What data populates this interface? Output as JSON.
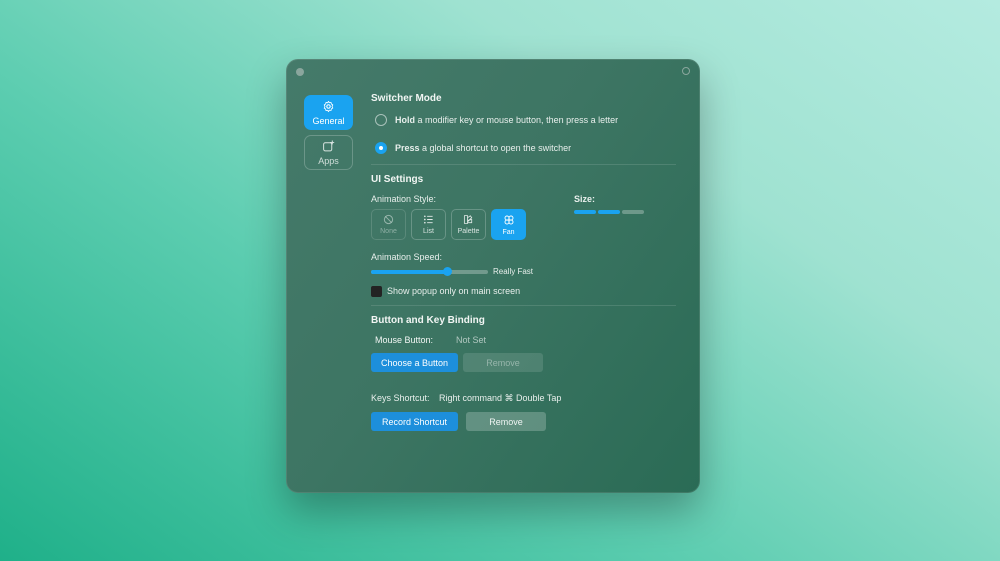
{
  "sidebar": {
    "tabs": [
      {
        "label": "General",
        "icon": "gear-icon",
        "active": true
      },
      {
        "label": "Apps",
        "icon": "app-add-icon",
        "active": false
      }
    ]
  },
  "switcher_mode": {
    "title": "Switcher Mode",
    "options": [
      {
        "bold": "Hold",
        "text": " a modifier key or mouse button, then press a letter",
        "selected": false
      },
      {
        "bold": "Press",
        "text": " a global shortcut to open the switcher",
        "selected": true
      }
    ]
  },
  "ui_settings": {
    "title": "UI Settings",
    "animation_style_label": "Animation Style:",
    "animation_styles": [
      {
        "label": "None",
        "icon": "prohibited-icon",
        "state": "disabled"
      },
      {
        "label": "List",
        "icon": "list-icon",
        "state": "off"
      },
      {
        "label": "Palette",
        "icon": "palette-icon",
        "state": "off"
      },
      {
        "label": "Fan",
        "icon": "fan-icon",
        "state": "selected"
      }
    ],
    "size_label": "Size:",
    "size_level": 2,
    "size_max": 3,
    "animation_speed_label": "Animation Speed:",
    "animation_speed_fraction": 0.65,
    "animation_speed_value": "Really Fast",
    "popup_main_screen_label": "Show popup only on main screen",
    "popup_main_screen_checked": false
  },
  "binding": {
    "title": "Button and Key Binding",
    "mouse_button_label": "Mouse Button:",
    "mouse_button_value": "Not Set",
    "choose_button_label": "Choose a Button",
    "remove_mouse_label": "Remove",
    "keys_shortcut_label": "Keys Shortcut:",
    "keys_shortcut_value": "Right command ⌘ Double Tap",
    "record_shortcut_label": "Record Shortcut",
    "remove_shortcut_label": "Remove"
  },
  "colors": {
    "accent": "#1aa3f0",
    "window_bg": "#3d7563",
    "desktop_bg": "#5ccdb0"
  }
}
